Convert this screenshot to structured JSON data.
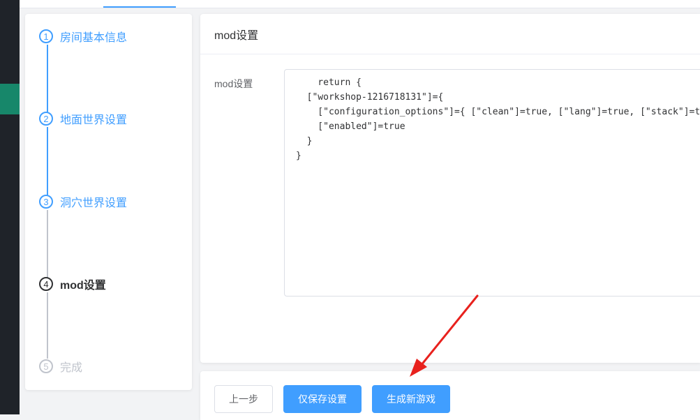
{
  "steps": [
    {
      "number": "1",
      "label": "房间基本信息",
      "status": "done"
    },
    {
      "number": "2",
      "label": "地面世界设置",
      "status": "done"
    },
    {
      "number": "3",
      "label": "洞穴世界设置",
      "status": "done"
    },
    {
      "number": "4",
      "label": "mod设置",
      "status": "current"
    },
    {
      "number": "5",
      "label": "完成",
      "status": "wait"
    }
  ],
  "card": {
    "title": "mod设置",
    "field_label": "mod设置",
    "code": "    return {\n  [\"workshop-1216718131\"]={\n    [\"configuration_options\"]={ [\"clean\"]=true, [\"lang\"]=true, [\"stack\"]=true },\n    [\"enabled\"]=true\n  }\n}"
  },
  "actions": {
    "prev_label": "上一步",
    "save_label": "仅保存设置",
    "generate_label": "生成新游戏"
  },
  "colors": {
    "accent": "#409eff",
    "annotation_arrow": "#e8211d",
    "sidebar_dark": "#1f2329",
    "sidebar_active": "#17876a"
  }
}
